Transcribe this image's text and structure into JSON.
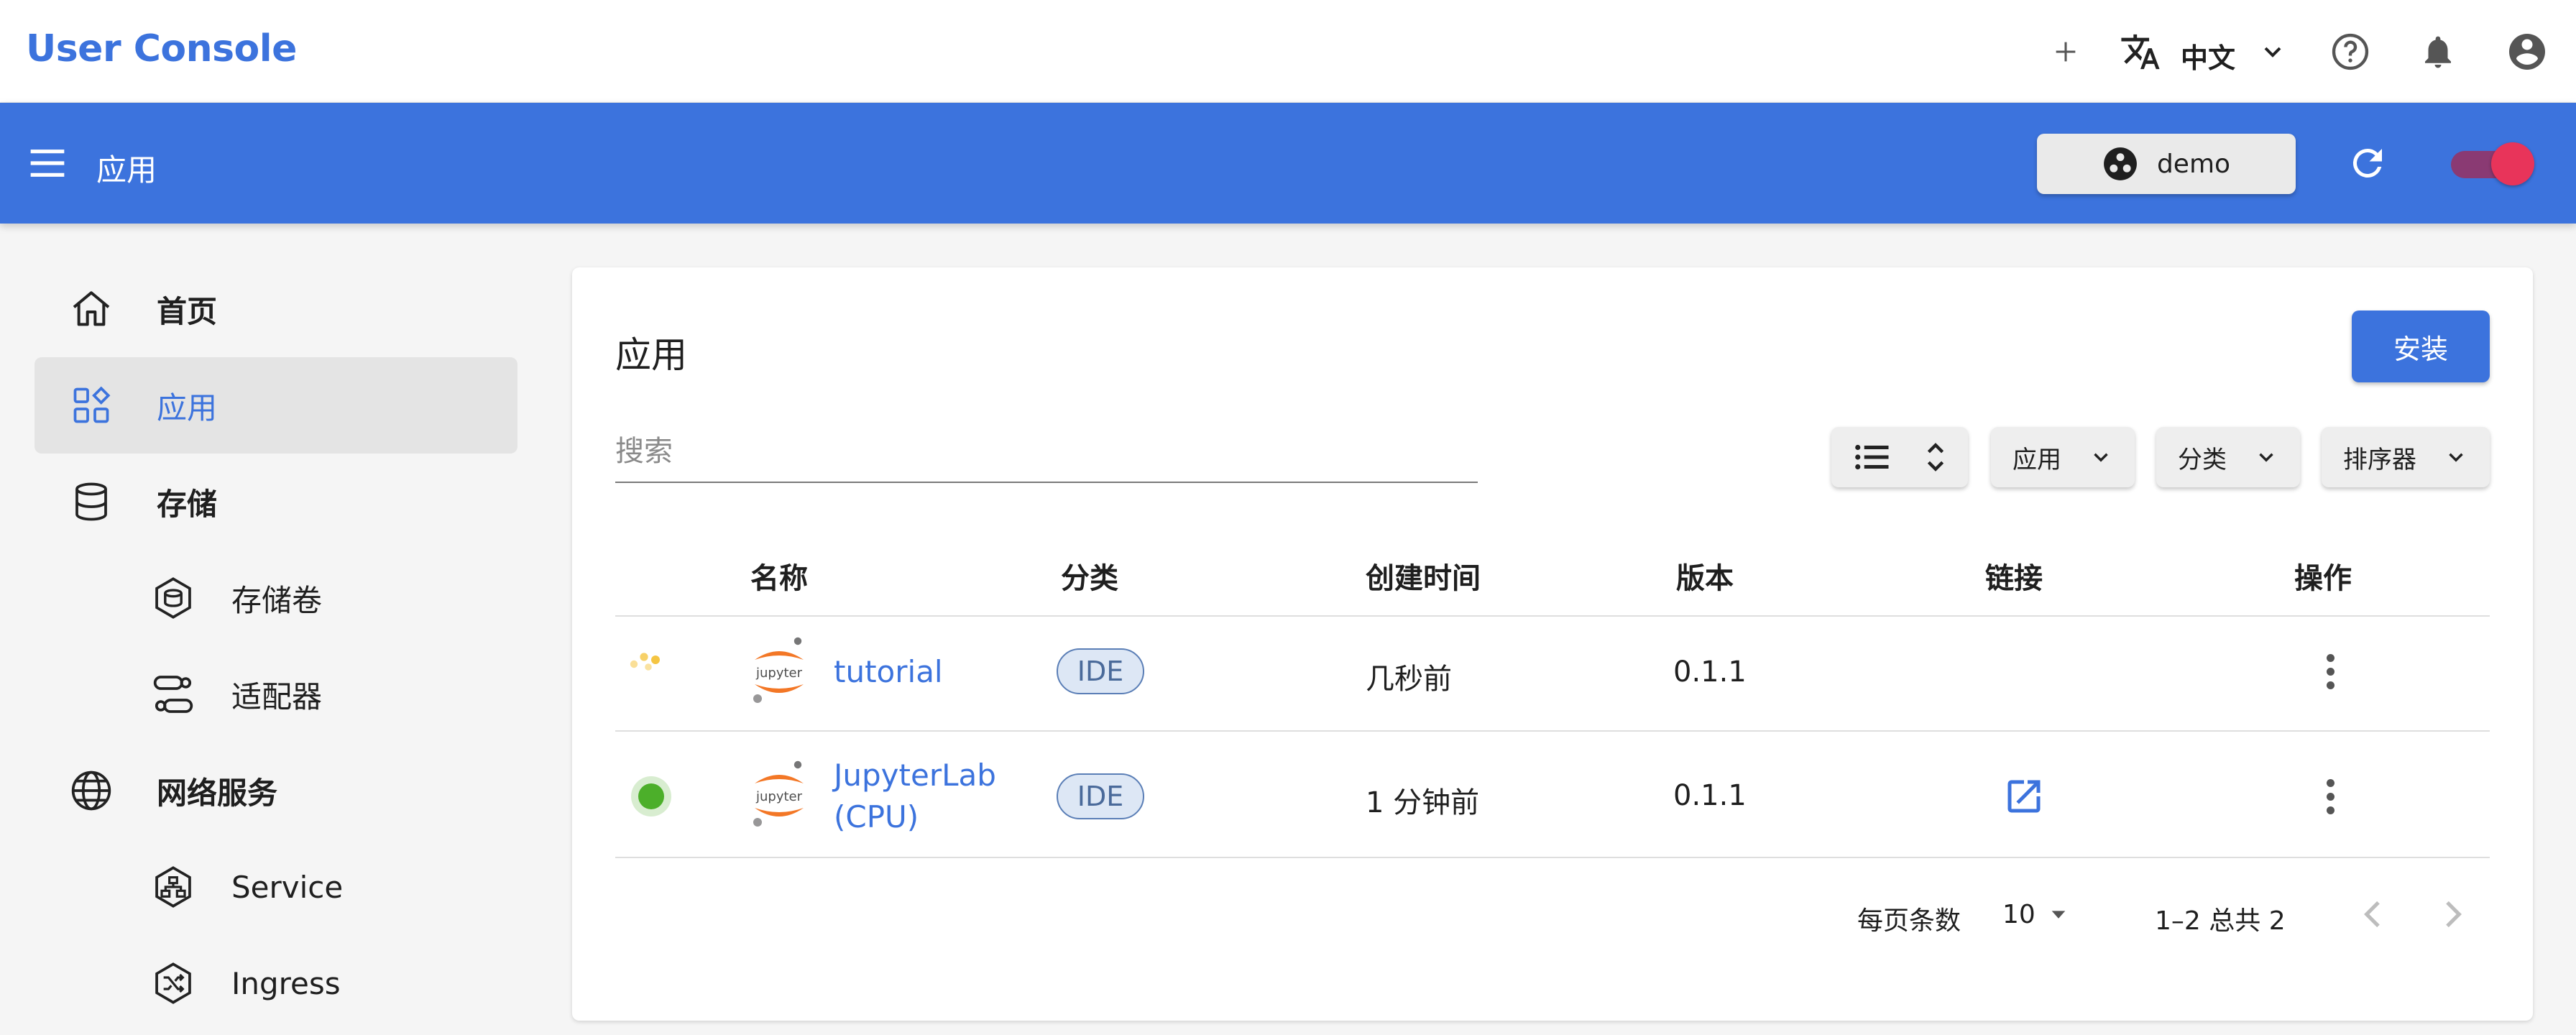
{
  "header": {
    "brand": "User Console",
    "language": "中文",
    "icons": [
      "add-icon",
      "translate-icon",
      "chevron-down-icon",
      "help-icon",
      "bell-icon",
      "account-icon"
    ]
  },
  "appbar": {
    "title": "应用",
    "namespace": "demo"
  },
  "sidebar": {
    "items": [
      {
        "label": "首页",
        "icon": "home-icon"
      },
      {
        "label": "应用",
        "icon": "apps-icon",
        "active": true
      },
      {
        "label": "存储",
        "icon": "database-icon"
      },
      {
        "label": "存储卷",
        "icon": "volume-icon"
      },
      {
        "label": "适配器",
        "icon": "adapter-icon"
      },
      {
        "label": "网络服务",
        "icon": "globe-icon"
      },
      {
        "label": "Service",
        "icon": "service-icon"
      },
      {
        "label": "Ingress",
        "icon": "ingress-icon"
      }
    ]
  },
  "main": {
    "title": "应用",
    "install_label": "安装",
    "search_placeholder": "搜索",
    "filters": {
      "app": "应用",
      "category": "分类",
      "sorter": "排序器"
    },
    "columns": [
      "名称",
      "分类",
      "创建时间",
      "版本",
      "链接",
      "操作"
    ],
    "rows": [
      {
        "name": "tutorial",
        "category": "IDE",
        "created": "几秒前",
        "version": "0.1.1",
        "status": "pending"
      },
      {
        "name_line1": "JupyterLab",
        "name_line2": "(CPU)",
        "category": "IDE",
        "created": "1 分钟前",
        "version": "0.1.1",
        "status": "running"
      }
    ],
    "logo_text": "jupyter",
    "pagination": {
      "rows_per_page_label": "每页条数",
      "rows_per_page": "10",
      "range": "1–2 总共 2"
    }
  },
  "colors": {
    "primary": "#3c73dd",
    "running": "#4caf2a",
    "pending": "#f5c542",
    "toggle": "#e8345a"
  }
}
